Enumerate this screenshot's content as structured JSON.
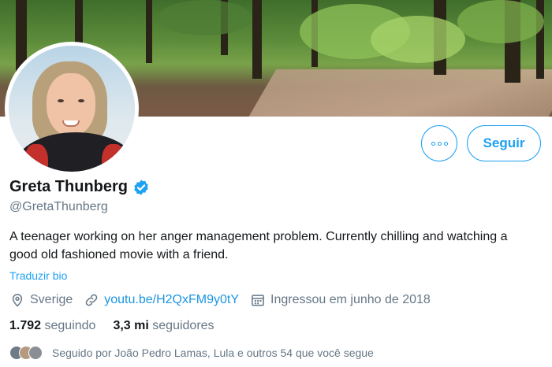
{
  "profile": {
    "name": "Greta Thunberg",
    "handle": "@GretaThunberg",
    "bio": "A teenager working on her anger management problem. Currently chilling and watching a good old fashioned movie with a friend.",
    "translate_label": "Traduzir bio",
    "location": "Sverige",
    "link": "youtu.be/H2QxFM9y0tY",
    "joined": "Ingressou em junho de 2018",
    "following_count": "1.792",
    "following_label": "seguindo",
    "followers_count": "3,3 mi",
    "followers_label": "seguidores",
    "followed_by": "Seguido por João Pedro Lamas, Lula e outros 54 que você segue"
  },
  "actions": {
    "follow_label": "Seguir"
  },
  "icons": {
    "more": "more-options-icon",
    "verified": "verified-badge-icon",
    "location": "location-pin-icon",
    "link": "link-icon",
    "calendar": "calendar-icon"
  },
  "colors": {
    "accent": "#1da1f2",
    "link": "#1b95e0",
    "muted": "#657786",
    "text": "#14171a"
  }
}
